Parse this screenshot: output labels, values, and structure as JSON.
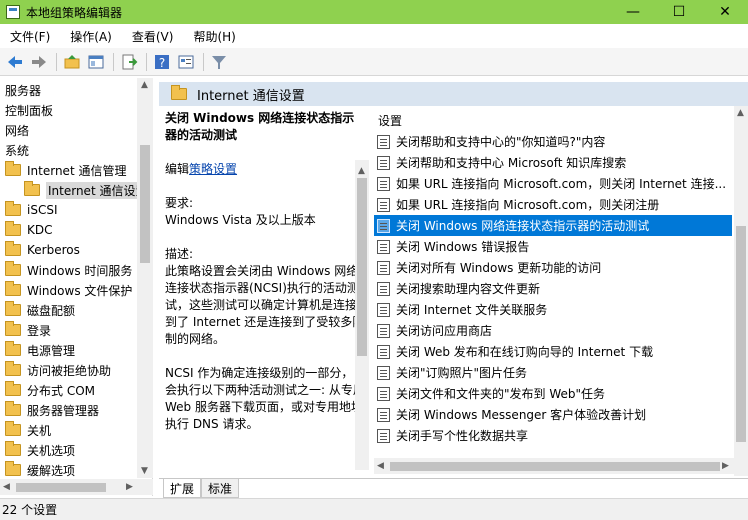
{
  "window": {
    "title": "本地组策略编辑器",
    "minimize": "—",
    "maximize": "☐",
    "close": "✕"
  },
  "menu": [
    "文件(F)",
    "操作(A)",
    "查看(V)",
    "帮助(H)"
  ],
  "toolbar": {
    "icons": [
      "back-arrow-icon",
      "forward-arrow-icon",
      "up-folder-icon",
      "show-tree-icon",
      "export-list-icon",
      "help-icon",
      "properties-icon",
      "filter-icon"
    ]
  },
  "tree": {
    "items": [
      {
        "label": "服务器",
        "indent": 0,
        "folder": false
      },
      {
        "label": "控制面板",
        "indent": 0,
        "folder": false
      },
      {
        "label": "网络",
        "indent": 0,
        "folder": false
      },
      {
        "label": "系统",
        "indent": 0,
        "folder": false
      },
      {
        "label": "Internet 通信管理",
        "indent": 1,
        "folder": true
      },
      {
        "label": "Internet 通信设置",
        "indent": 2,
        "folder": true,
        "selected": true
      },
      {
        "label": "iSCSI",
        "indent": 1,
        "folder": true
      },
      {
        "label": "KDC",
        "indent": 1,
        "folder": true
      },
      {
        "label": "Kerberos",
        "indent": 1,
        "folder": true
      },
      {
        "label": "Windows 时间服务",
        "indent": 1,
        "folder": true
      },
      {
        "label": "Windows 文件保护",
        "indent": 1,
        "folder": true
      },
      {
        "label": "磁盘配额",
        "indent": 1,
        "folder": true
      },
      {
        "label": "登录",
        "indent": 1,
        "folder": true
      },
      {
        "label": "电源管理",
        "indent": 1,
        "folder": true
      },
      {
        "label": "访问被拒绝协助",
        "indent": 1,
        "folder": true
      },
      {
        "label": "分布式 COM",
        "indent": 1,
        "folder": true
      },
      {
        "label": "服务器管理器",
        "indent": 1,
        "folder": true
      },
      {
        "label": "关机",
        "indent": 1,
        "folder": true
      },
      {
        "label": "关机选项",
        "indent": 1,
        "folder": true
      },
      {
        "label": "缓解选项",
        "indent": 1,
        "folder": true
      }
    ]
  },
  "panel": {
    "header": "Internet 通信设置",
    "description": {
      "title": "关闭 Windows 网络连接状态指示器的活动测试",
      "edit_prefix": "编辑",
      "edit_link": "策略设置",
      "requirements_label": "要求:",
      "requirements_value": "Windows Vista 及以上版本",
      "desc_label": "描述:",
      "desc_p1": "此策略设置会关闭由 Windows 网络连接状态指示器(NCSI)执行的活动测试，这些测试可以确定计算机是连接到了 Internet 还是连接到了受较多限制的网络。",
      "desc_p2": "NCSI 作为确定连接级别的一部分，会执行以下两种活动测试之一: 从专用 Web 服务器下载页面，或对专用地址执行 DNS 请求。"
    },
    "list_header": "设置",
    "settings": [
      {
        "label": "关闭帮助和支持中心的\"你知道吗?\"内容"
      },
      {
        "label": "关闭帮助和支持中心 Microsoft 知识库搜索"
      },
      {
        "label": "如果 URL 连接指向 Microsoft.com，则关闭 Internet 连接..."
      },
      {
        "label": "如果 URL 连接指向 Microsoft.com，则关闭注册"
      },
      {
        "label": "关闭 Windows 网络连接状态指示器的活动测试",
        "selected": true
      },
      {
        "label": "关闭 Windows 错误报告"
      },
      {
        "label": "关闭对所有 Windows 更新功能的访问"
      },
      {
        "label": "关闭搜索助理内容文件更新"
      },
      {
        "label": "关闭 Internet 文件关联服务"
      },
      {
        "label": "关闭访问应用商店"
      },
      {
        "label": "关闭 Web 发布和在线订购向导的 Internet 下载"
      },
      {
        "label": "关闭\"订购照片\"图片任务"
      },
      {
        "label": "关闭文件和文件夹的\"发布到 Web\"任务"
      },
      {
        "label": "关闭 Windows Messenger 客户体验改善计划"
      },
      {
        "label": "关闭手写个性化数据共享"
      }
    ]
  },
  "tabs": [
    "扩展",
    "标准"
  ],
  "status": "22 个设置",
  "colors": {
    "titlebar": "#8fd14f",
    "selection": "#0078d7",
    "header_band": "#d9e4f0"
  }
}
